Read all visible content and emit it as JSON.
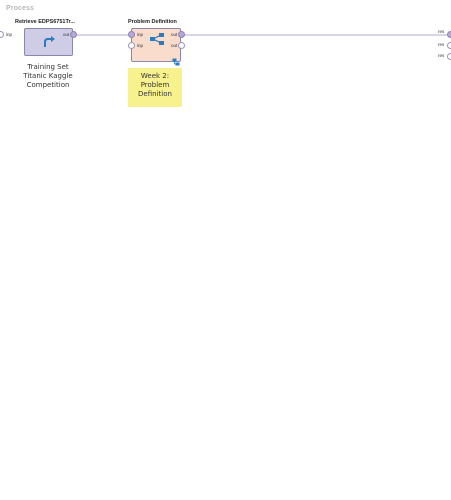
{
  "process": {
    "title": "Process",
    "input_port_label": "inp",
    "result_port_labels": [
      "res",
      "res",
      "res"
    ]
  },
  "operators": {
    "retrieve": {
      "title": "Retrieve EDPS6751Tr...",
      "out_port_label": "out",
      "icon": "retrieve-arrow-icon",
      "caption_lines": [
        "Training Set",
        "Titanic Kaggle",
        "Competition"
      ]
    },
    "problem_definition": {
      "title": "Problem Definition",
      "in_port_labels": [
        "inp",
        "inp"
      ],
      "out_port_labels": [
        "out",
        "out"
      ],
      "icon": "subprocess-network-icon",
      "subprocess_badge_icon": "subprocess-badge-icon"
    }
  },
  "note": {
    "lines": [
      "Week 2:",
      "Problem",
      "Definition"
    ]
  },
  "colors": {
    "wire": "#b4aed3",
    "port_fill": "#b4a9d3",
    "retrieve_fill": "#cfcde6",
    "subprocess_fill": "#f9dccc",
    "note_fill": "#f8f28e",
    "icon_blue": "#2a7bbf"
  }
}
